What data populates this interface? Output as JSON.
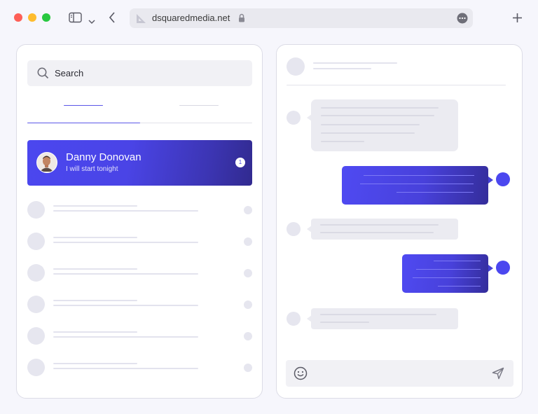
{
  "browser": {
    "url": "dsquaredmedia.net",
    "traffic_colors": [
      "#fe5f57",
      "#febc2e",
      "#28c840"
    ]
  },
  "sidebar": {
    "search_placeholder": "Search",
    "active_chat": {
      "name": "Danny Donovan",
      "preview": "I will start tonight",
      "unread_count": "1"
    }
  },
  "colors": {
    "accent": "#4b47ef",
    "accent_dark": "#312a8f",
    "placeholder": "#e6e6ef"
  },
  "icons": [
    "sidebar-icon",
    "chevron-down-icon",
    "back-icon",
    "site-icon",
    "lock-icon",
    "more-icon",
    "plus-icon",
    "search-icon",
    "emoji-icon",
    "send-icon"
  ]
}
